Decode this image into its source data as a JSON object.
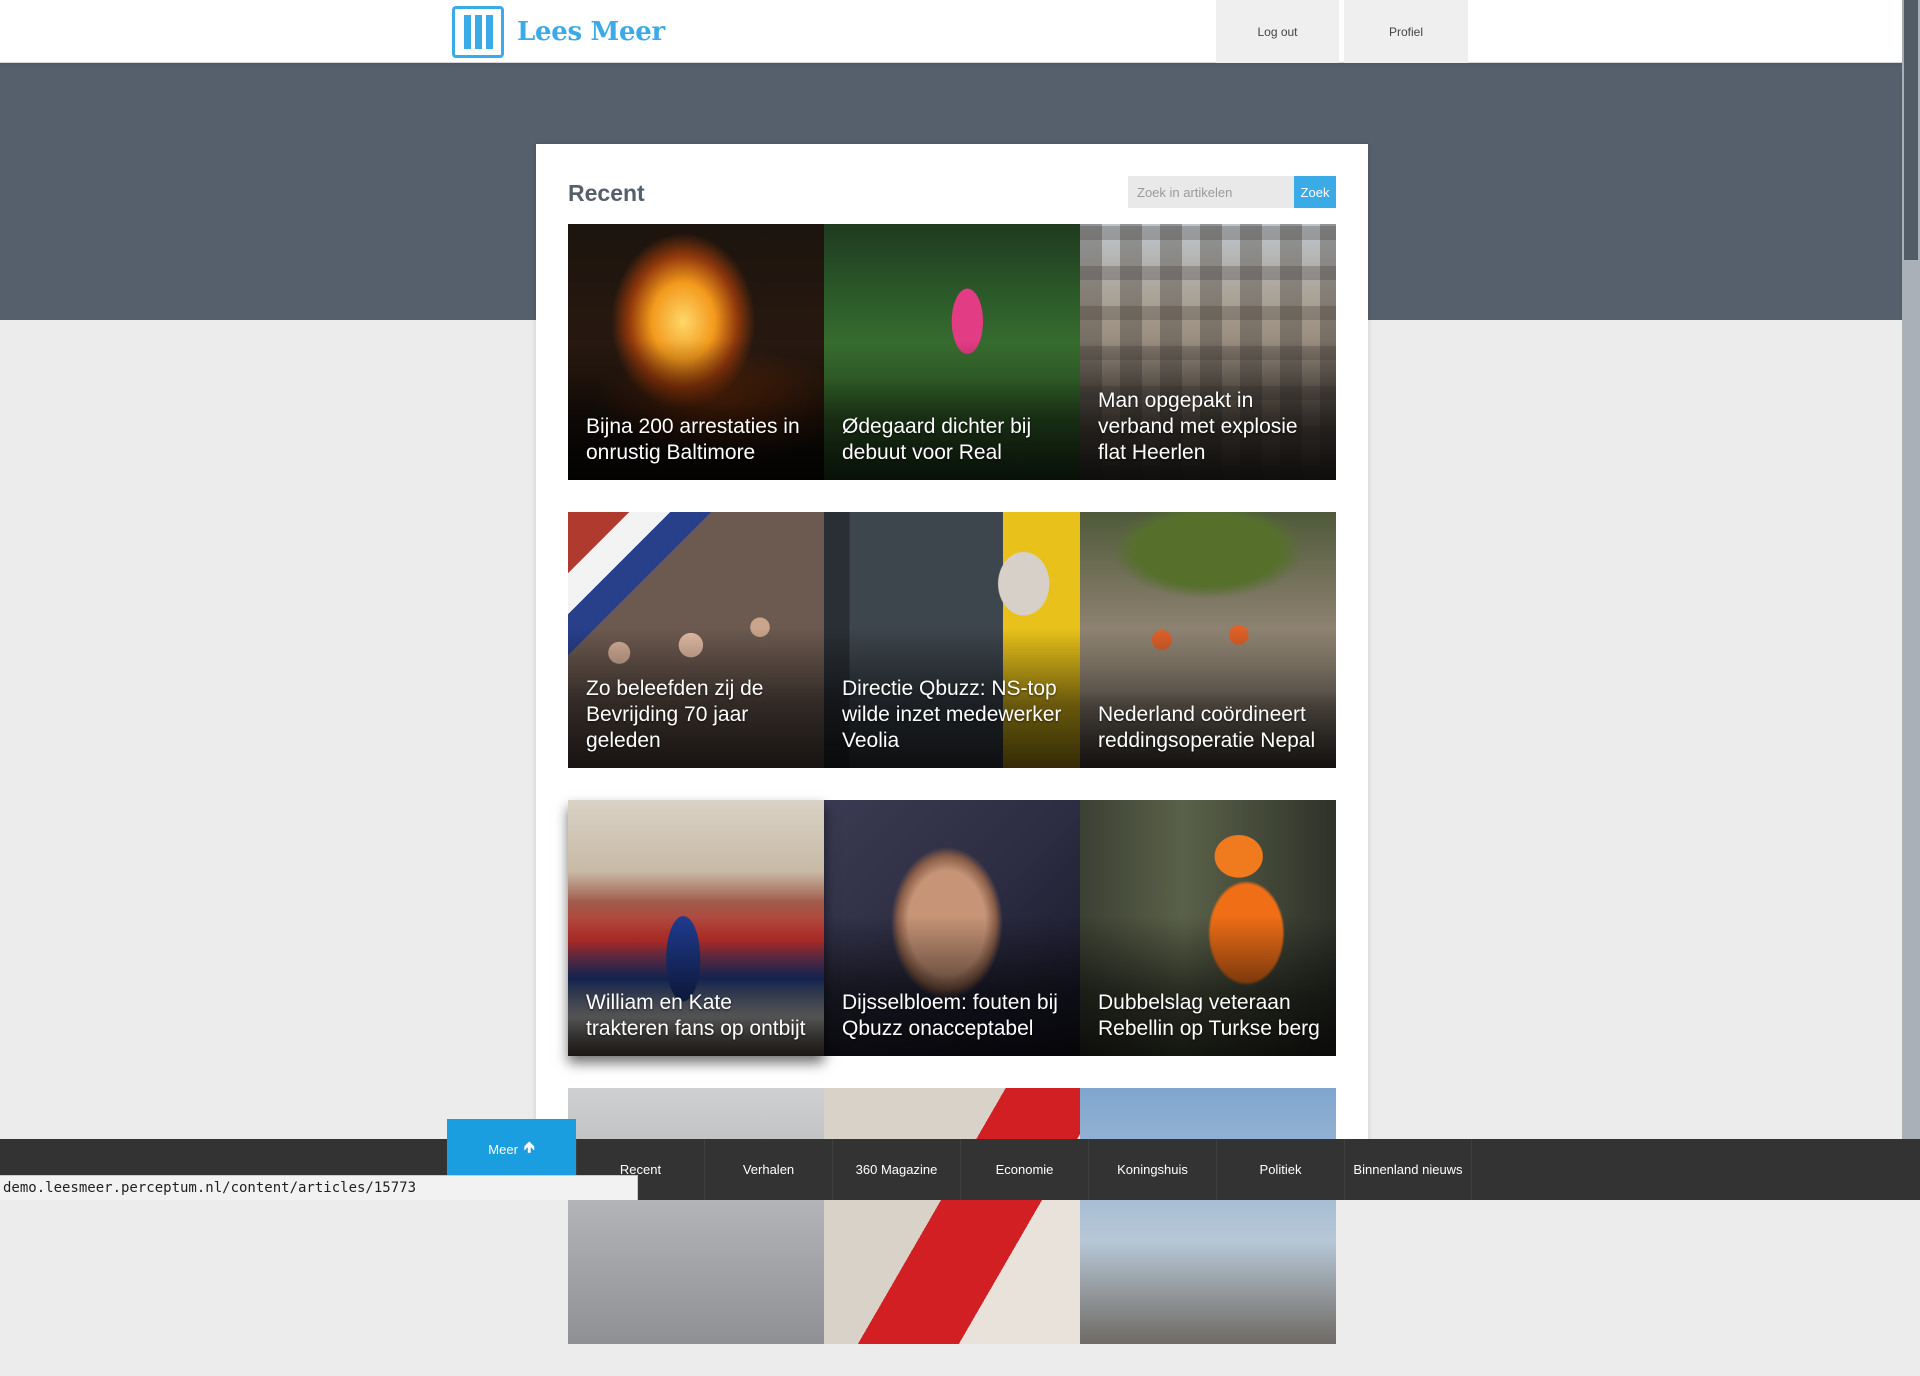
{
  "header": {
    "logo_text": "Lees Meer",
    "logout_label": "Log out",
    "profile_label": "Profiel"
  },
  "panel": {
    "title": "Recent",
    "search_placeholder": "Zoek in artikelen",
    "search_button": "Zoek"
  },
  "articles": [
    {
      "title": "Bijna 200 arrestaties in onrustig Baltimore",
      "image": "riot-fire-photo"
    },
    {
      "title": "Ødegaard dichter bij debuut voor Real",
      "image": "football-player-photo"
    },
    {
      "title": "Man opgepakt in verband met explosie flat Heerlen",
      "image": "damaged-building-photo"
    },
    {
      "title": "Zo beleefden zij de Bevrijding 70 jaar geleden",
      "image": "liberation-crowd-photo"
    },
    {
      "title": "Directie Qbuzz: NS-top wilde inzet medewerker Veolia",
      "image": "bus-passenger-photo"
    },
    {
      "title": "Nederland coördineert reddingsoperatie Nepal",
      "image": "rescue-workers-photo"
    },
    {
      "title": "William en Kate trakteren fans op ontbijt",
      "image": "royal-fans-photo"
    },
    {
      "title": "Dijsselbloem: fouten bij Qbuzz onacceptabel",
      "image": "portrait-photo"
    },
    {
      "title": "Dubbelslag veteraan Rebellin op Turkse berg",
      "image": "cyclist-photo"
    }
  ],
  "bottom_nav": {
    "more_label": "Meer",
    "items": [
      "Recent",
      "Verhalen",
      "360 Magazine",
      "Economie",
      "Koningshuis",
      "Politiek",
      "Binnenland nieuws"
    ]
  },
  "status_url": "demo.leesmeer.perceptum.nl/content/articles/15773",
  "colors": {
    "accent": "#3aabe6",
    "hero_band": "#56606c",
    "nav_bar": "#333333",
    "more_button": "#1a9ee0"
  }
}
